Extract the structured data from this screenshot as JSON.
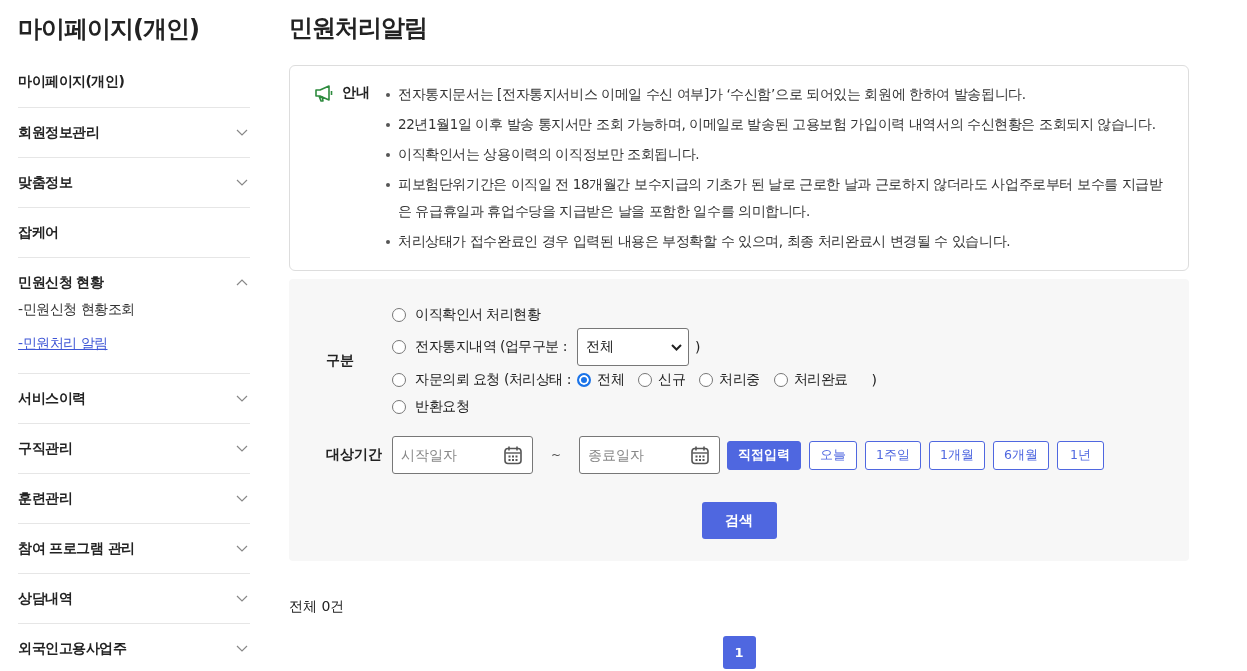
{
  "sidebar": {
    "title": "마이페이지(개인)",
    "items": [
      {
        "label": "마이페이지(개인)",
        "kind": "plain"
      },
      {
        "label": "회원정보관리",
        "kind": "menu",
        "expanded": false
      },
      {
        "label": "맞춤정보",
        "kind": "menu",
        "expanded": false
      },
      {
        "label": "잡케어",
        "kind": "plain"
      },
      {
        "label": "민원신청 현황",
        "kind": "menu",
        "expanded": true,
        "children": [
          {
            "label": "-민원신청 현황조회",
            "selected": false
          },
          {
            "label": "-민원처리 알림",
            "selected": true
          }
        ]
      },
      {
        "label": "서비스이력",
        "kind": "menu",
        "expanded": false
      },
      {
        "label": "구직관리",
        "kind": "menu",
        "expanded": false
      },
      {
        "label": "훈련관리",
        "kind": "menu",
        "expanded": false
      },
      {
        "label": "참여 프로그램 관리",
        "kind": "menu",
        "expanded": false
      },
      {
        "label": "상담내역",
        "kind": "menu",
        "expanded": false
      },
      {
        "label": "외국인고용사업주",
        "kind": "menu",
        "expanded": false
      }
    ]
  },
  "page_title": "민원처리알림",
  "notice": {
    "label": "안내",
    "lines": [
      "전자통지문서는 [전자통지서비스 이메일 수신 여부]가 ‘수신함’으로 되어있는 회원에 한하여 발송됩니다.",
      "22년1월1일 이후 발송 통지서만 조회 가능하며, 이메일로 발송된 고용보험 가입이력 내역서의 수신현황은 조회되지 않습니다.",
      "이직확인서는 상용이력의 이직정보만 조회됩니다.",
      "피보험단위기간은 이직일 전 18개월간 보수지급의 기초가 된 날로 근로한 날과 근로하지 않더라도 사업주로부터 보수를 지급받은 유급휴일과 휴업수당을 지급받은 날을 포함한 일수를 의미합니다.",
      "처리상태가 접수완료인 경우 입력된 내용은 부정확할 수 있으며, 최종 처리완료시 변경될 수 있습니다."
    ]
  },
  "filter": {
    "category_label": "구분",
    "categories": [
      {
        "kind": "plain",
        "label": "이직확인서 처리현황",
        "selected": false
      },
      {
        "kind": "select",
        "label": "전자통지내역 (업무구분 :",
        "value": "전체",
        "close": ")",
        "selected": false
      },
      {
        "kind": "status",
        "label": "자문의뢰 요청 (처리상태 :",
        "close": ")",
        "selected": false,
        "options": [
          {
            "label": "전체",
            "selected": true
          },
          {
            "label": "신규",
            "selected": false
          },
          {
            "label": "처리중",
            "selected": false
          },
          {
            "label": "처리완료",
            "selected": false
          }
        ]
      },
      {
        "kind": "plain",
        "label": "반환요청",
        "selected": false
      }
    ],
    "period_label": "대상기간",
    "start_placeholder": "시작일자",
    "separator": "~",
    "end_placeholder": "종료일자",
    "ranges": [
      {
        "label": "직접입력",
        "selected": true
      },
      {
        "label": "오늘",
        "selected": false
      },
      {
        "label": "1주일",
        "selected": false
      },
      {
        "label": "1개월",
        "selected": false
      },
      {
        "label": "6개월",
        "selected": false
      },
      {
        "label": "1년",
        "selected": false
      }
    ],
    "search_button": "검색"
  },
  "total": "전체 0건",
  "pages": [
    {
      "label": "1",
      "selected": true
    }
  ]
}
